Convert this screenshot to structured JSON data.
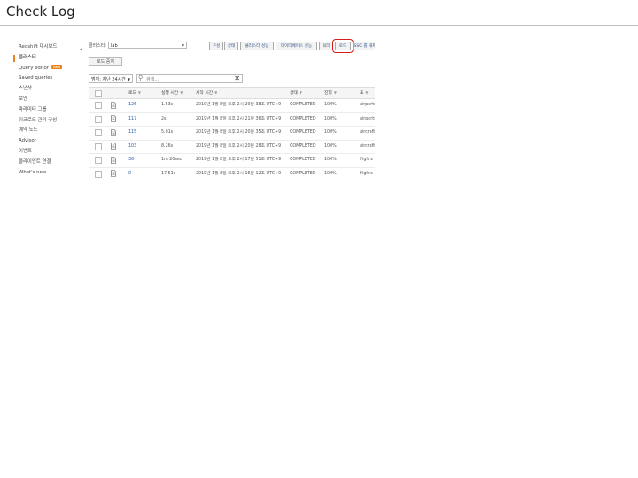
{
  "slide": {
    "title": "Check Log"
  },
  "sidebar": {
    "items": [
      {
        "label": "Redshift 대시보드",
        "active": false
      },
      {
        "label": "클러스터",
        "active": true
      },
      {
        "label": "Query editor",
        "active": false,
        "badge": "New"
      },
      {
        "label": "Saved queries",
        "active": false
      },
      {
        "label": "스냅샷",
        "active": false
      },
      {
        "label": "보안",
        "active": false
      },
      {
        "label": "파라미터 그룹",
        "active": false
      },
      {
        "label": "워크로드 관리 구성",
        "active": false
      },
      {
        "label": "예약 노드",
        "active": false
      },
      {
        "label": "Advisor",
        "active": false
      },
      {
        "label": "이벤트",
        "active": false
      },
      {
        "label": "클라이언트 연결",
        "active": false
      },
      {
        "label": "What's new",
        "active": false
      }
    ],
    "collapse_glyph": "◂"
  },
  "toolbar": {
    "cluster_label": "클러스터:",
    "cluster_value": "lab",
    "buttons": [
      {
        "label": "구성",
        "highlight": false
      },
      {
        "label": "상태",
        "highlight": false
      },
      {
        "label": "클러스터 성능",
        "highlight": false
      },
      {
        "label": "데이터베이스 성능",
        "highlight": false
      },
      {
        "label": "쿼리",
        "highlight": false
      },
      {
        "label": "로드",
        "highlight": true
      },
      {
        "label": "SSO 를 해제",
        "highlight": false
      }
    ]
  },
  "load_button": "로드 중지",
  "filter": {
    "select_value": "범위: 지난 24시간",
    "search_placeholder": "검색…",
    "clear_glyph": "✕"
  },
  "table": {
    "columns": [
      "",
      "",
      "로드",
      "실행 시간",
      "시작 시간",
      "상태",
      "진행",
      "표"
    ],
    "rows": [
      {
        "load": "126",
        "duration": "1.53s",
        "start": "2019년 1월 8일 오후 2시 29분 38초 UTC+9",
        "status": "COMPLETED",
        "progress": "100%",
        "table": "airports"
      },
      {
        "load": "117",
        "duration": "2s",
        "start": "2019년 1월 8일 오후 2시 21분 36초 UTC+9",
        "status": "COMPLETED",
        "progress": "100%",
        "table": "airports"
      },
      {
        "load": "115",
        "duration": "5.01s",
        "start": "2019년 1월 8일 오후 2시 20분 35초 UTC+9",
        "status": "COMPLETED",
        "progress": "100%",
        "table": "aircraft"
      },
      {
        "load": "103",
        "duration": "8.26s",
        "start": "2019년 1월 8일 오후 2시 20분 28초 UTC+9",
        "status": "COMPLETED",
        "progress": "100%",
        "table": "aircraft"
      },
      {
        "load": "36",
        "duration": "1m 20sec",
        "start": "2019년 1월 8일 오후 2시 17분 51초 UTC+9",
        "status": "COMPLETED",
        "progress": "100%",
        "table": "flights"
      },
      {
        "load": "0",
        "duration": "17.51s",
        "start": "2019년 1월 8일 오후 2시 16분 12초 UTC+9",
        "status": "COMPLETED",
        "progress": "100%",
        "table": "flights"
      }
    ]
  },
  "colors": {
    "accent": "#e8841b",
    "highlight": "#d71a1a",
    "link": "#1c5aa8"
  },
  "icons": {
    "row_icon": "document-icon",
    "search": "search-icon",
    "dropdown": "chevron-down-icon"
  }
}
